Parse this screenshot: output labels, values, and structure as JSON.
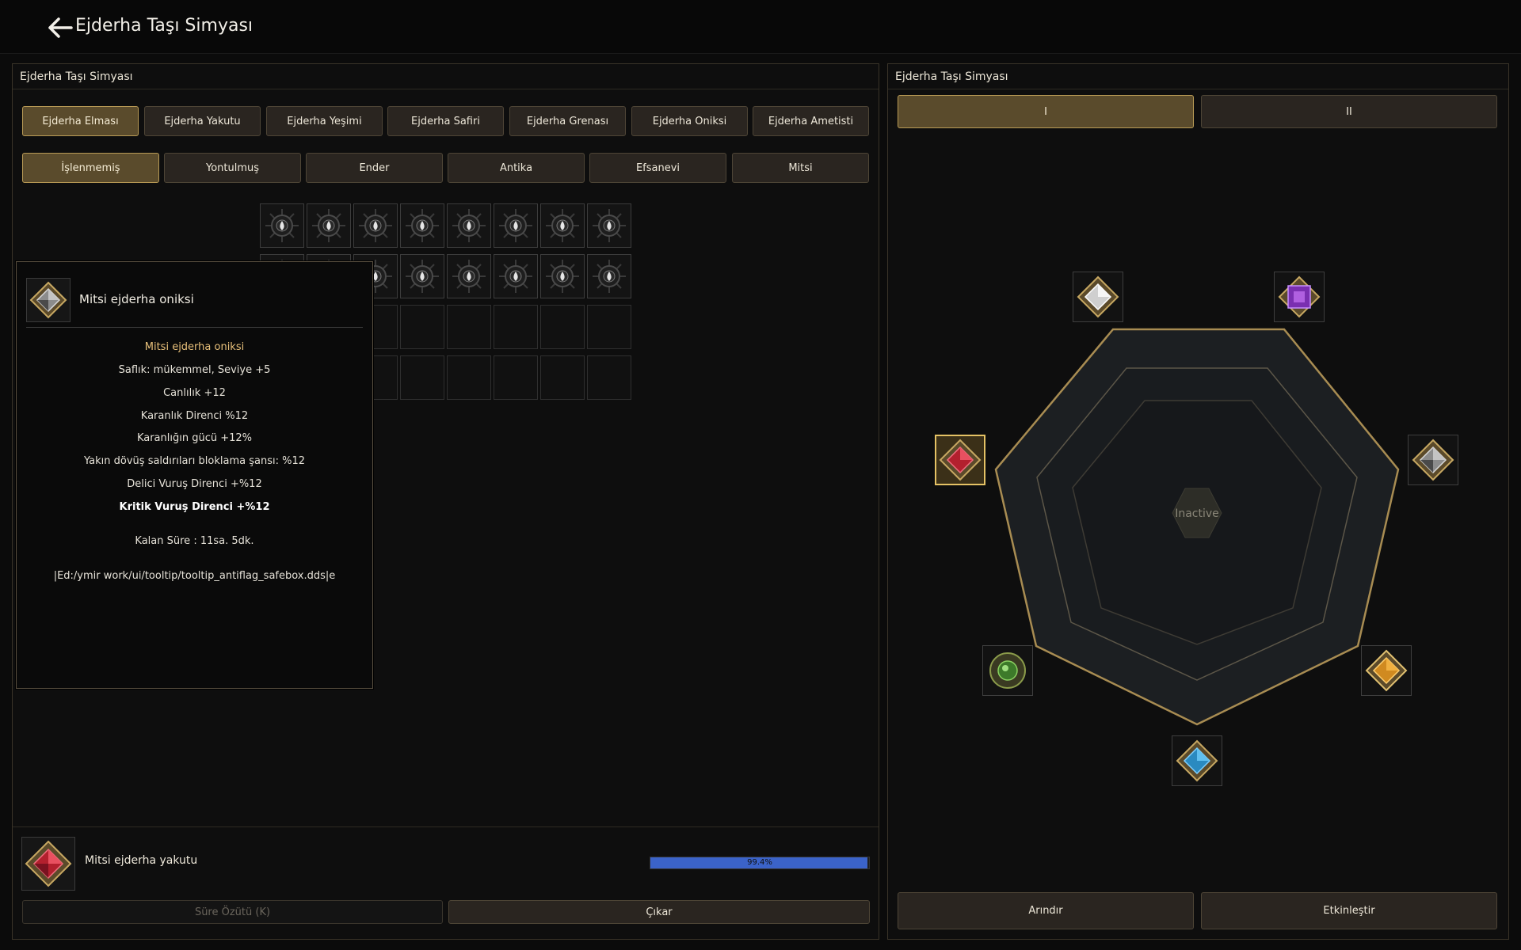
{
  "app": {
    "title": "Ejderha Taşı Simyası"
  },
  "left_panel": {
    "title": "Ejderha Taşı Simyası",
    "stone_tabs": [
      "Ejderha Elması",
      "Ejderha Yakutu",
      "Ejderha Yeşimi",
      "Ejderha Safiri",
      "Ejderha Grenası",
      "Ejderha Oniksi",
      "Ejderha Ametisti"
    ],
    "active_stone_tab": 0,
    "grade_tabs": [
      "İşlenmemiş",
      "Yontulmuş",
      "Ender",
      "Antika",
      "Efsanevi",
      "Mitsi"
    ],
    "active_grade_tab": 0,
    "inventory": {
      "filled_slots": 18,
      "total_slots": 32
    }
  },
  "tooltip": {
    "name": "Mitsi ejderha oniksi",
    "lines": [
      {
        "text": "Mitsi ejderha oniksi",
        "style": "gold"
      },
      {
        "text": "Saflık: mükemmel, Seviye +5",
        "style": "normal"
      },
      {
        "text": "Canlılık +12",
        "style": "normal"
      },
      {
        "text": "Karanlık Direnci %12",
        "style": "normal"
      },
      {
        "text": "Karanlığın gücü +12%",
        "style": "normal"
      },
      {
        "text": "Yakın dövüş saldırıları bloklama şansı: %12",
        "style": "normal"
      },
      {
        "text": "Delici Vuruş Direnci +%12",
        "style": "normal"
      },
      {
        "text": "Kritik Vuruş Direnci +%12",
        "style": "bold"
      },
      {
        "text": "Kalan Süre : 11sa. 5dk.",
        "style": "normal"
      },
      {
        "text": "|Ed:/ymir work/ui/tooltip/tooltip_antiflag_safebox.dds|e",
        "style": "normal"
      }
    ]
  },
  "selected_item": {
    "name": "Mitsi ejderha yakutu",
    "progress_text": "99.4%",
    "progress_value": 0.994,
    "btn_time": "Süre Özütü (K)",
    "btn_remove": "Çıkar"
  },
  "right_panel": {
    "title": "Ejderha Taşı Simyası",
    "page_tabs": [
      "I",
      "II"
    ],
    "active_page": 0,
    "center_label": "Inactive",
    "btn_refine": "Arındır",
    "btn_activate": "Etkinleştir"
  },
  "colors": {
    "accent_gold": "#b89a55",
    "progress_blue": "#3b63c9",
    "tooltip_title": "#e8c07a"
  },
  "gems": [
    {
      "icon": "diamond-gem-icon",
      "color": "#d8d8d8"
    },
    {
      "icon": "amethyst-gem-icon",
      "color": "#8a3fc0"
    },
    {
      "icon": "onyx-gem-icon",
      "color": "#7a7a7a"
    },
    {
      "icon": "garnet-gem-icon",
      "color": "#e0a030"
    },
    {
      "icon": "sapphire-gem-icon",
      "color": "#3aa8d8"
    },
    {
      "icon": "jade-gem-icon",
      "color": "#5a9a3a"
    },
    {
      "icon": "ruby-gem-icon",
      "color": "#d02a3a"
    }
  ]
}
